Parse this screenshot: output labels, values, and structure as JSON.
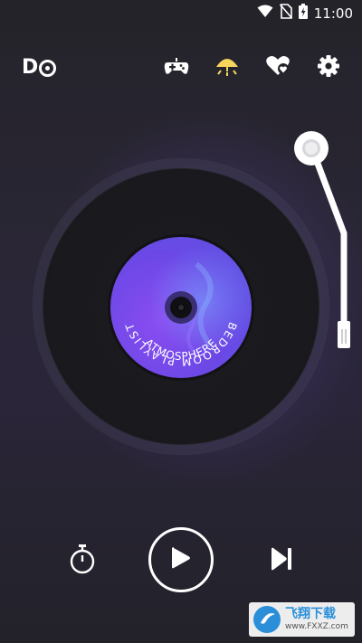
{
  "status_bar": {
    "time": "11:00",
    "icons": [
      "wifi-icon",
      "no-sim-icon",
      "battery-charging-icon"
    ]
  },
  "toolbar": {
    "logo_text": "DO",
    "icons": [
      "gamepad-icon",
      "night-lamp-icon",
      "favorites-heart-icon",
      "settings-gear-icon"
    ],
    "accent_lamp_color": "#f6d55c"
  },
  "record": {
    "label_top_text": "BEDROOM PLAYLIST",
    "label_bottom_text": "ATMOSPHERE",
    "label_color": "#6b48e6"
  },
  "controls": {
    "icons": [
      "timer-icon",
      "play-icon",
      "skip-next-icon"
    ],
    "is_playing": false
  },
  "watermark": {
    "brand": "飞翔下载",
    "url": "www.FXXZ.com"
  }
}
